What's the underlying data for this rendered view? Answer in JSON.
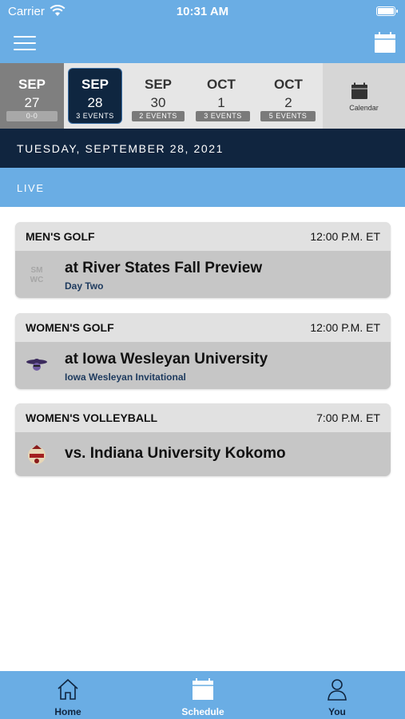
{
  "status_bar": {
    "carrier": "Carrier",
    "time": "10:31 AM"
  },
  "date_strip": {
    "items": [
      {
        "month": "SEP",
        "day": "27",
        "events": "0-0",
        "state": "past"
      },
      {
        "month": "SEP",
        "day": "28",
        "events": "3 EVENTS",
        "state": "selected"
      },
      {
        "month": "SEP",
        "day": "30",
        "events": "2 EVENTS",
        "state": "normal"
      },
      {
        "month": "OCT",
        "day": "1",
        "events": "3 EVENTS",
        "state": "normal"
      },
      {
        "month": "OCT",
        "day": "2",
        "events": "5 EVENTS",
        "state": "normal"
      }
    ],
    "calendar_label": "Calendar"
  },
  "date_header": "TUESDAY, SEPTEMBER 28, 2021",
  "section_label": "LIVE",
  "events": [
    {
      "sport": "MEN'S GOLF",
      "time": "12:00 P.M. ET",
      "opponent": "at River States Fall Preview",
      "subtitle": "Day Two",
      "logo": "smwc-logo-icon"
    },
    {
      "sport": "WOMEN'S GOLF",
      "time": "12:00 P.M. ET",
      "opponent": "at Iowa Wesleyan University",
      "subtitle": "Iowa Wesleyan Invitational",
      "logo": "iowa-wesleyan-logo-icon"
    },
    {
      "sport": "WOMEN'S VOLLEYBALL",
      "time": "7:00 P.M. ET",
      "opponent": "vs. Indiana University Kokomo",
      "subtitle": "",
      "logo": "iu-kokomo-logo-icon"
    }
  ],
  "tab_bar": {
    "tabs": [
      {
        "label": "Home",
        "icon": "home-icon",
        "active": false
      },
      {
        "label": "Schedule",
        "icon": "calendar-icon",
        "active": true
      },
      {
        "label": "You",
        "icon": "person-icon",
        "active": false
      }
    ]
  },
  "colors": {
    "primary_light": "#6aade4",
    "primary_dark": "#10253f",
    "card_body": "#c6c6c6",
    "card_header": "#e1e1e1",
    "date_strip": "#e6e6e6"
  }
}
